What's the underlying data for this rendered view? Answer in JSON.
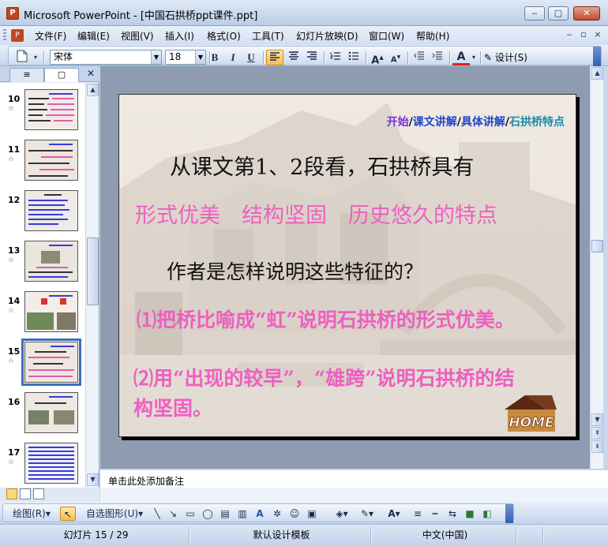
{
  "window": {
    "title": "Microsoft PowerPoint - [中国石拱桥ppt课件.ppt]",
    "minimize": "‒",
    "maximize": "▢",
    "close": "✕"
  },
  "menu": {
    "items": [
      "文件(F)",
      "编辑(E)",
      "视图(V)",
      "插入(I)",
      "格式(O)",
      "工具(T)",
      "幻灯片放映(D)",
      "窗口(W)",
      "帮助(H)"
    ],
    "doc_min": "‒",
    "doc_restore": "▫",
    "doc_close": "×"
  },
  "toolbar": {
    "font_name": "宋体",
    "font_size": "18",
    "bold": "B",
    "italic": "I",
    "underline": "U",
    "font_color_label": "A",
    "design_label": "设计(S)",
    "grow_font": "A",
    "shrink_font": "A"
  },
  "left_pane": {
    "tab_outline": "≡",
    "tab_slides": "▢",
    "close": "✕",
    "slides": [
      {
        "num": "10",
        "selected": false
      },
      {
        "num": "11",
        "selected": false
      },
      {
        "num": "12",
        "selected": false
      },
      {
        "num": "13",
        "selected": false
      },
      {
        "num": "14",
        "selected": false
      },
      {
        "num": "15",
        "selected": true
      },
      {
        "num": "16",
        "selected": false
      },
      {
        "num": "17",
        "selected": false
      }
    ],
    "star": "☆"
  },
  "slide": {
    "nav": {
      "start": "开始",
      "sep1": "/",
      "lesson": "课文讲解",
      "sep2": "/",
      "detail": "具体讲解",
      "sep3": "/",
      "features": "石拱桥特点"
    },
    "line1": "从课文第1、2段看，石拱桥具有",
    "line2": "形式优美　结构坚固　历史悠久的特点",
    "line3": "作者是怎样说明这些特征的？",
    "line4": "⑴把桥比喻成“虹”说明石拱桥的形式优美。",
    "line5a": "⑵用“出现的较早”，“雄跨”说明石拱桥的结",
    "line5b": "构坚固。",
    "home_label": "HOME",
    "colors": {
      "nav_purple": "#7b2fd6",
      "nav_blue": "#1f47c8",
      "nav_teal": "#1a8aa8",
      "pink": "#ee5fc1",
      "dark": "#111111"
    }
  },
  "notes": {
    "placeholder": "单击此处添加备注"
  },
  "draw_toolbar": {
    "draw": "绘图(R)",
    "autoshapes": "自选图形(U)"
  },
  "status": {
    "slide_info": "幻灯片 15 / 29",
    "template": "默认设计模板",
    "language": "中文(中国)"
  }
}
